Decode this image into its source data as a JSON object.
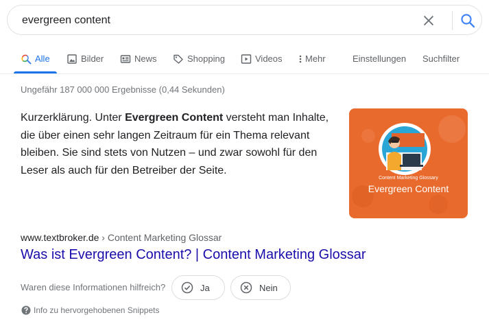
{
  "search": {
    "query": "evergreen content"
  },
  "tabs": [
    {
      "label": "Alle",
      "icon": "search-icon",
      "active": true
    },
    {
      "label": "Bilder",
      "icon": "image-icon"
    },
    {
      "label": "News",
      "icon": "news-icon"
    },
    {
      "label": "Shopping",
      "icon": "tag-icon"
    },
    {
      "label": "Videos",
      "icon": "play-icon"
    },
    {
      "label": "Mehr",
      "icon": "more-vert-icon"
    }
  ],
  "tools": {
    "settings_label": "Einstellungen",
    "filter_label": "Suchfilter"
  },
  "result_stats": "Ungefähr 187 000 000 Ergebnisse (0,44 Sekunden)",
  "snippet": {
    "prefix": "Kurzerklärung. Unter ",
    "bold": "Evergreen Content",
    "suffix": " versteht man Inhalte, die über einen sehr langen Zeitraum für ein Thema relevant bleiben. Sie sind stets von Nutzen – und zwar sowohl für den Leser als auch für den Betreiber der Seite.",
    "image_caption_small": "Content Marketing Glossary",
    "image_caption_large": "Evergreen Content"
  },
  "result": {
    "domain": "www.textbroker.de",
    "breadcrumb": " › Content Marketing Glossar",
    "title": "Was ist Evergreen Content? | Content Marketing Glossar"
  },
  "feedback": {
    "question": "Waren diese Informationen hilfreich?",
    "yes_label": "Ja",
    "no_label": "Nein"
  },
  "snippet_info": "Info zu hervorgehobenen Snippets",
  "colors": {
    "link": "#1a0dab",
    "accent": "#1a73e8",
    "thumbnail_bg": "#e96a2d"
  }
}
